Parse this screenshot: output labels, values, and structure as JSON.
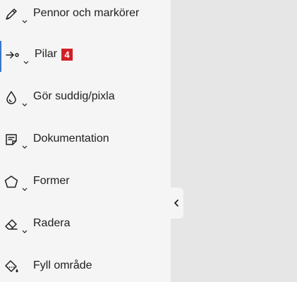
{
  "panel": {
    "tools": [
      {
        "label": "Pennor och markörer",
        "icon": "pen-icon"
      },
      {
        "label": "Pilar",
        "icon": "arrow-icon",
        "badge": "4",
        "active": true
      },
      {
        "label": "Gör suddig/pixla",
        "icon": "blur-drop-icon"
      },
      {
        "label": "Dokumentation",
        "icon": "note-icon"
      },
      {
        "label": "Former",
        "icon": "pentagon-icon"
      },
      {
        "label": "Radera",
        "icon": "eraser-icon"
      },
      {
        "label": "Fyll område",
        "icon": "fill-bucket-icon"
      }
    ]
  },
  "colors": {
    "panel_bg": "#f5f5f5",
    "canvas_bg": "#e6e6e6",
    "badge_bg": "#d21f26",
    "active_indicator": "#3a78c9"
  },
  "collapse_button": {
    "icon": "chevron-left-icon"
  }
}
